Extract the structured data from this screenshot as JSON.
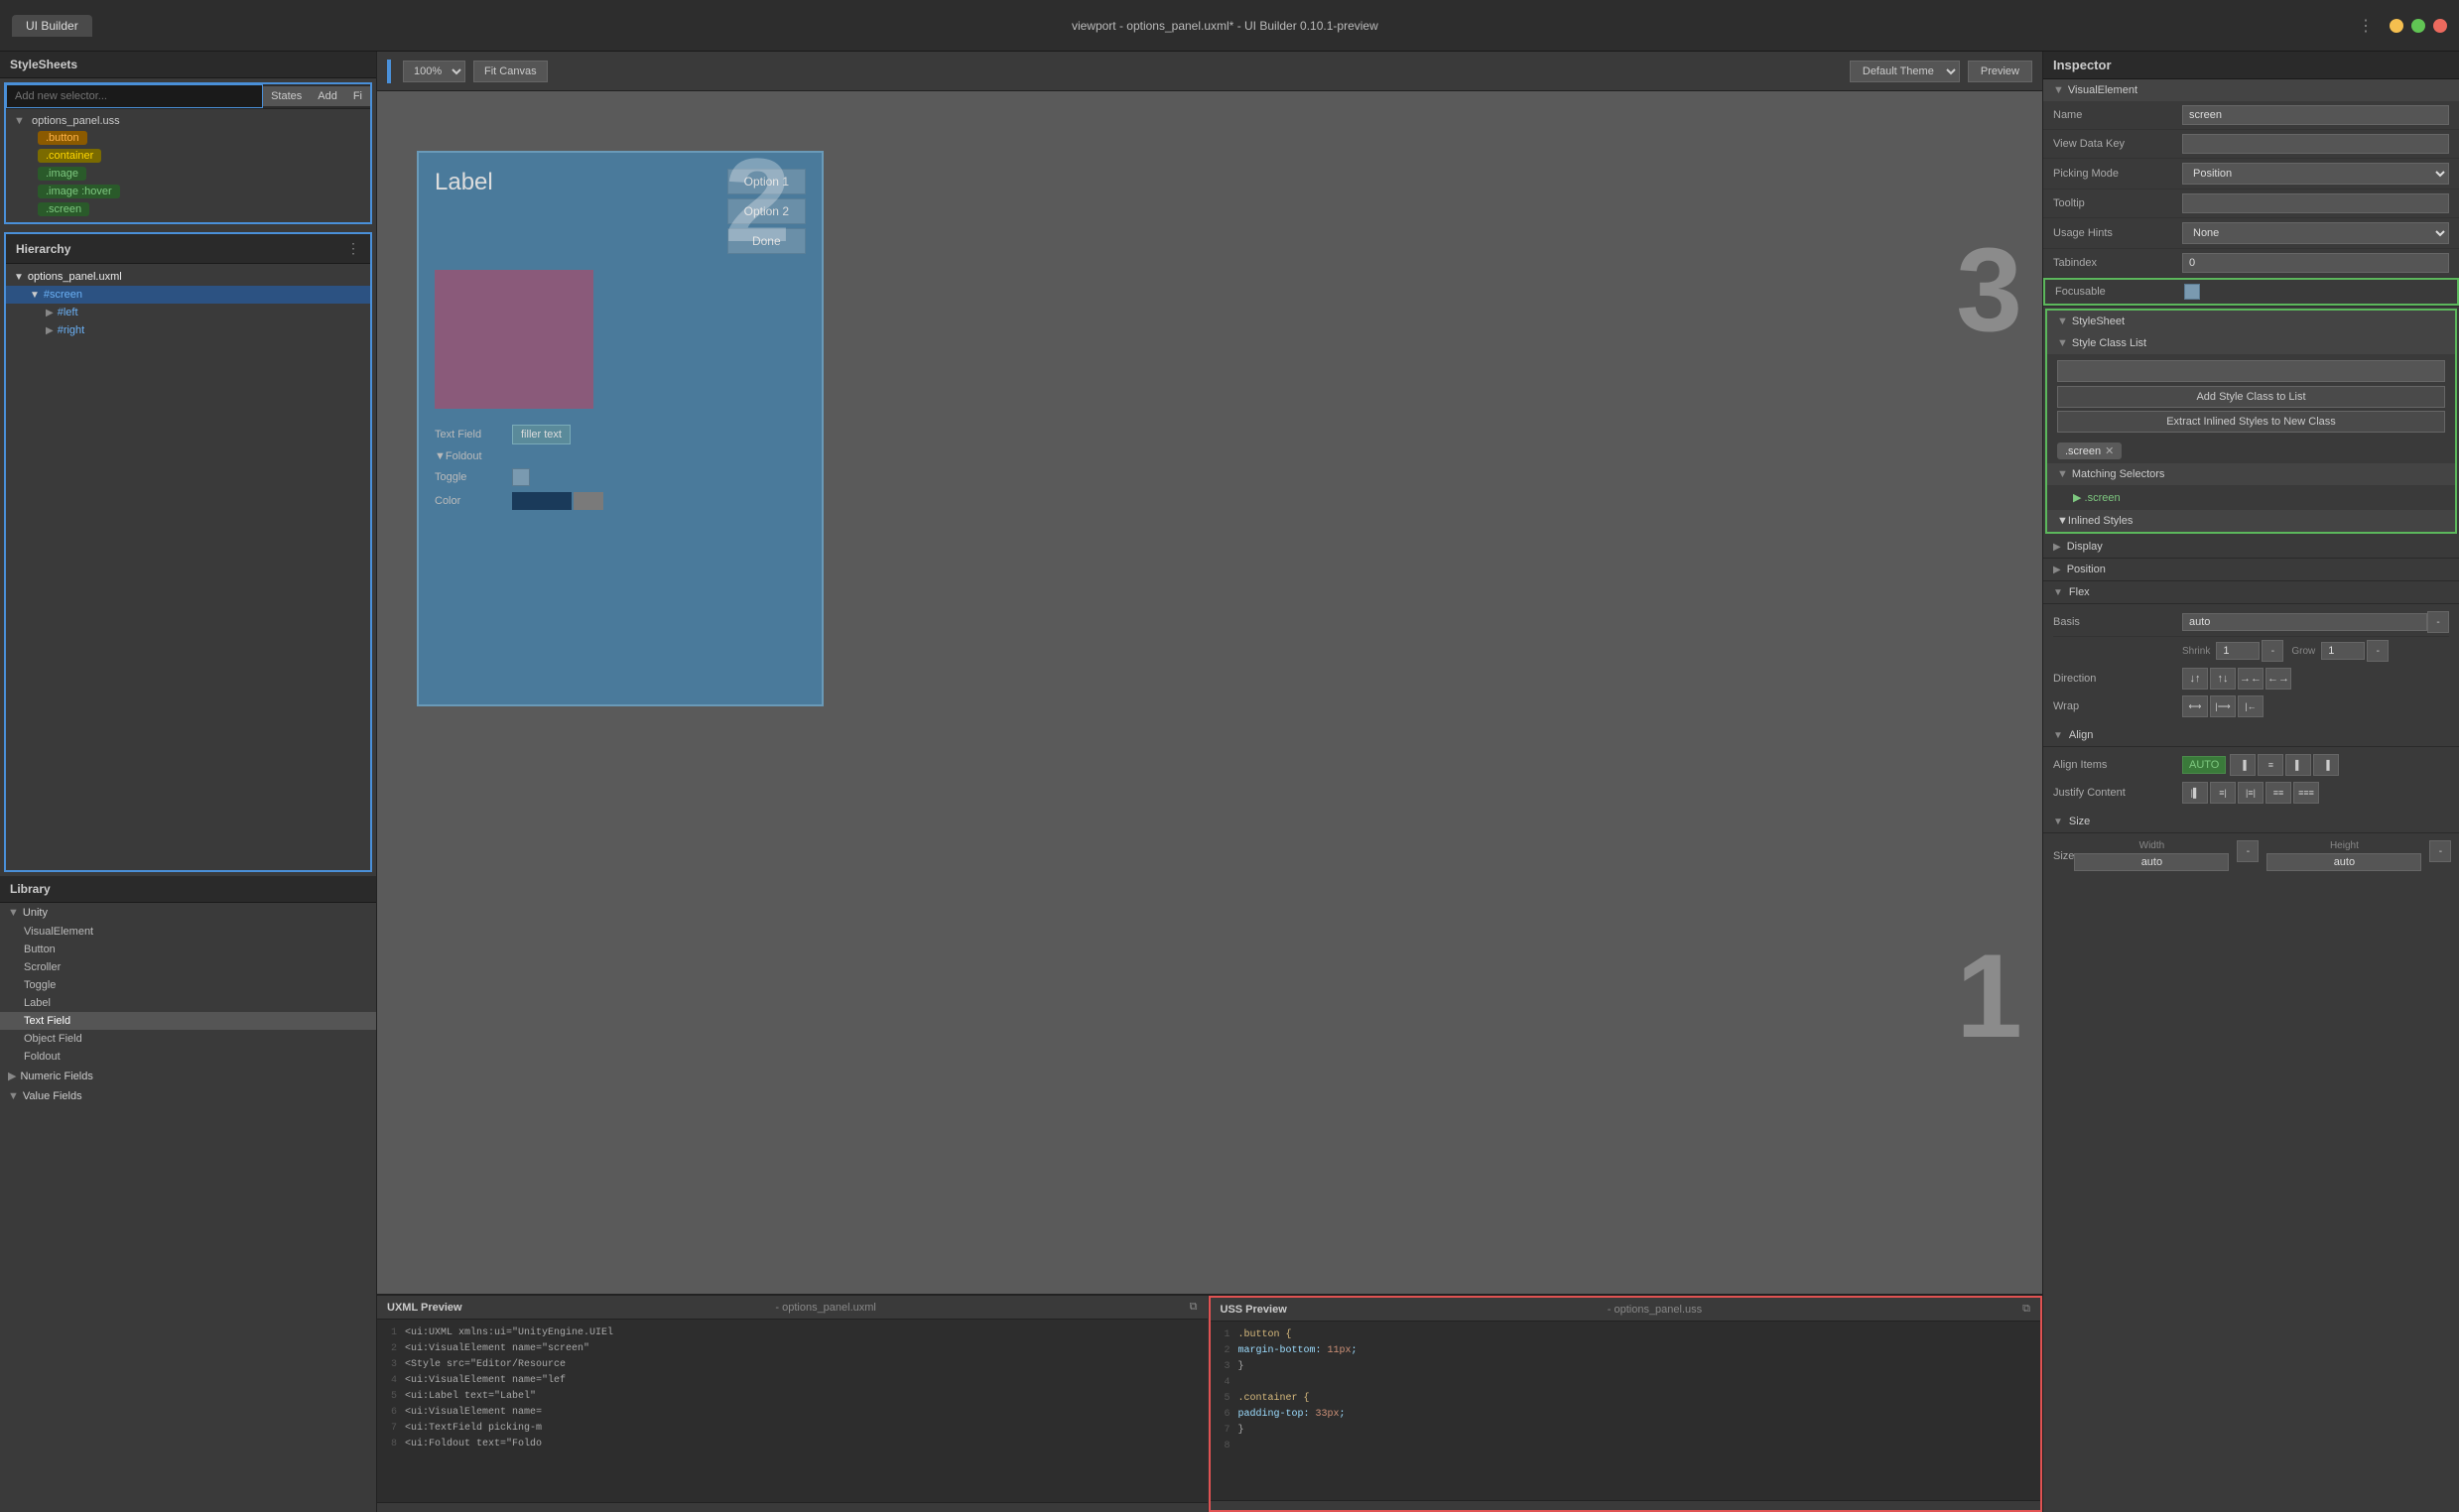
{
  "titlebar": {
    "tab": "UI Builder",
    "center_text": "viewport - options_panel.uxml* - UI Builder 0.10.1-preview"
  },
  "toolbar": {
    "zoom": "100%",
    "fit_canvas": "Fit Canvas",
    "theme": "Default Theme",
    "preview": "Preview"
  },
  "stylesheets": {
    "panel_title": "StyleSheets",
    "new_selector_placeholder": "Add new selector...",
    "states_btn": "States",
    "add_btn": "Add",
    "filter_btn": "Fi",
    "file": {
      "name": "options_panel.uss",
      "classes": [
        ".button",
        ".container",
        ".image",
        ".image :hover",
        ".screen"
      ]
    }
  },
  "hierarchy": {
    "panel_title": "Hierarchy",
    "dots": "⋮",
    "tree": {
      "root": "options_panel.uxml",
      "screen": "#screen",
      "left": "#left",
      "right": "#right"
    }
  },
  "library": {
    "panel_title": "Library",
    "categories": [
      {
        "name": "Unity",
        "items": [
          "VisualElement",
          "Button",
          "Scroller",
          "Toggle",
          "Label",
          "Text Field",
          "Object Field",
          "Foldout",
          "Numeric Fields",
          "Value Fields"
        ]
      }
    ]
  },
  "canvas": {
    "label": "Label",
    "option1": "Option 1",
    "option2": "Option 2",
    "done": "Done",
    "text_field_label": "Text Field",
    "foldout_label": "▼Foldout",
    "toggle_label": "Toggle",
    "color_label": "Color",
    "filler_text": "filler text"
  },
  "uxml_preview": {
    "title": "UXML Preview",
    "file": "options_panel.uxml",
    "lines": [
      {
        "num": 1,
        "text": "<ui:UXML xmlns:ui=\"UnityEngine.UIEl"
      },
      {
        "num": 2,
        "text": "  <ui:VisualElement name=\"screen\""
      },
      {
        "num": 3,
        "text": "    <Style src=\"Editor/Resource"
      },
      {
        "num": 4,
        "text": "    <ui:VisualElement name=\"lef"
      },
      {
        "num": 5,
        "text": "      <ui:Label text=\"Label\""
      },
      {
        "num": 6,
        "text": "      <ui:VisualElement name="
      },
      {
        "num": 7,
        "text": "      <ui:TextField picking-m"
      },
      {
        "num": 8,
        "text": "      <ui:Foldout text=\"Foldo"
      }
    ]
  },
  "uss_preview": {
    "title": "USS Preview",
    "file": "options_panel.uss",
    "lines": [
      {
        "num": 1,
        "text": ".button {"
      },
      {
        "num": 2,
        "text": "    margin-bottom: 11px;"
      },
      {
        "num": 3,
        "text": "}"
      },
      {
        "num": 4,
        "text": ""
      },
      {
        "num": 5,
        "text": ".container {"
      },
      {
        "num": 6,
        "text": "    padding-top: 33px;"
      },
      {
        "num": 7,
        "text": "}"
      },
      {
        "num": 8,
        "text": ""
      }
    ]
  },
  "inspector": {
    "title": "Inspector",
    "visual_element": "VisualElement",
    "name_label": "Name",
    "name_value": "screen",
    "view_data_key_label": "View Data Key",
    "view_data_key_value": "",
    "picking_mode_label": "Picking Mode",
    "picking_mode_value": "Position",
    "tooltip_label": "Tooltip",
    "tooltip_value": "",
    "usage_hints_label": "Usage Hints",
    "usage_hints_value": "None",
    "tabindex_label": "Tabindex",
    "tabindex_value": "0",
    "focusable_label": "Focusable",
    "stylesheet_title": "StyleSheet",
    "style_class_list_title": "Style Class List",
    "add_style_class_btn": "Add Style Class to List",
    "extract_styles_btn": "Extract Inlined Styles to New Class",
    "class_tag": ".screen",
    "matching_selectors_title": "Matching Selectors",
    "matching_selector_item": "▶ .screen",
    "inlined_styles_title": "Inlined Styles",
    "display_title": "Display",
    "position_title": "Position",
    "flex_title": "Flex",
    "basis_label": "Basis",
    "basis_value": "auto",
    "shrink_label": "Shrink",
    "shrink_value": "1",
    "grow_label": "Grow",
    "grow_value": "1",
    "direction_label": "Direction",
    "wrap_label": "Wrap",
    "align_label": "Align",
    "align_items_label": "Align Items",
    "align_items_value": "AUTO",
    "justify_content_label": "Justify Content",
    "size_title": "Size",
    "size_label": "Size",
    "width_label": "Width",
    "height_label": "Height",
    "width_value": "auto",
    "height_value": "auto",
    "minus": "-"
  },
  "numbers": {
    "n1": "1",
    "n2": "2",
    "n3": "3"
  }
}
